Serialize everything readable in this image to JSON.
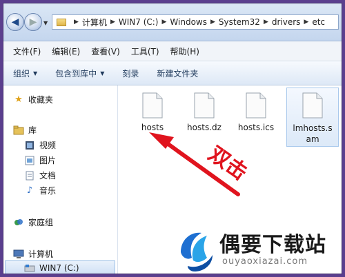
{
  "address": {
    "crumbs": [
      "计算机",
      "WIN7 (C:)",
      "Windows",
      "System32",
      "drivers",
      "etc"
    ]
  },
  "menu": [
    "文件(F)",
    "编辑(E)",
    "查看(V)",
    "工具(T)",
    "帮助(H)"
  ],
  "commands": {
    "organize": "组织",
    "include_library": "包含到库中",
    "burn": "刻录",
    "new_folder": "新建文件夹"
  },
  "nav": {
    "favorites": "收藏夹",
    "library": "库",
    "video": "视频",
    "pictures": "图片",
    "documents": "文档",
    "music": "音乐",
    "homegroup": "家庭组",
    "computer": "计算机",
    "drive": "WIN7 (C:)"
  },
  "files": [
    {
      "name": "hosts"
    },
    {
      "name": "hosts.dz"
    },
    {
      "name": "hosts.ics"
    },
    {
      "name": "lmhosts.sam"
    }
  ],
  "annotation": {
    "text": "双击",
    "color": "#e0141e"
  },
  "logo": {
    "title": "偶要下载站",
    "url": "ouyaoxiazai.com"
  }
}
